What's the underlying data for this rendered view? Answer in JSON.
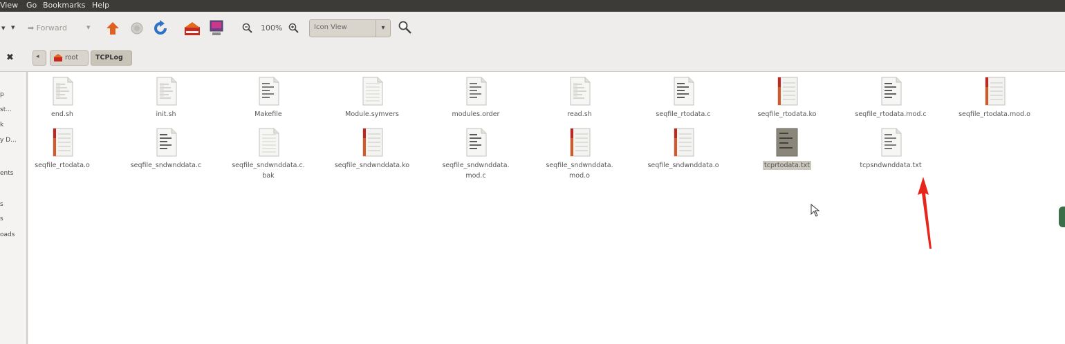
{
  "menu": {
    "items": [
      "View",
      "Go",
      "Bookmarks",
      "Help"
    ]
  },
  "toolbar": {
    "forward_label": "Forward",
    "zoom_label": "100%",
    "view_select": "Icon View"
  },
  "location": {
    "crumbs": [
      "root",
      "TCPLog"
    ]
  },
  "sidebar": {
    "items": [
      "p",
      "st...",
      "k",
      "y D...",
      "ents",
      "s",
      "s",
      "oads"
    ]
  },
  "files": [
    {
      "name": "end.sh",
      "type": "script",
      "selected": false
    },
    {
      "name": "init.sh",
      "type": "script",
      "selected": false
    },
    {
      "name": "Makefile",
      "type": "text",
      "selected": false
    },
    {
      "name": "Module.symvers",
      "type": "plain",
      "selected": false
    },
    {
      "name": "modules.order",
      "type": "text",
      "selected": false
    },
    {
      "name": "read.sh",
      "type": "script",
      "selected": false
    },
    {
      "name": "seqfile_rtodata.c",
      "type": "csrc",
      "selected": false
    },
    {
      "name": "seqfile_rtodata.ko",
      "type": "binary",
      "selected": false
    },
    {
      "name": "seqfile_rtodata.mod.c",
      "type": "csrc",
      "selected": false
    },
    {
      "name": "seqfile_rtodata.mod.o",
      "type": "binary",
      "selected": false
    },
    {
      "name": "seqfile_rtodata.o",
      "type": "binary",
      "selected": false
    },
    {
      "name": "seqfile_sndwnddata.c",
      "type": "csrc",
      "selected": false
    },
    {
      "name": "seqfile_sndwnddata.c.\nbak",
      "type": "plain",
      "selected": false
    },
    {
      "name": "seqfile_sndwnddata.ko",
      "type": "binary",
      "selected": false
    },
    {
      "name": "seqfile_sndwnddata.\nmod.c",
      "type": "csrc",
      "selected": false
    },
    {
      "name": "seqfile_sndwnddata.\nmod.o",
      "type": "binary",
      "selected": false
    },
    {
      "name": "seqfile_sndwnddata.o",
      "type": "binary",
      "selected": false
    },
    {
      "name": "tcprtodata.txt",
      "type": "textdark",
      "selected": true
    },
    {
      "name": "tcpsndwnddata.txt",
      "type": "text",
      "selected": false
    }
  ],
  "colors": {
    "menubar": "#3c3b37",
    "selection": "#cbc7bd",
    "arrow": "#e8251b"
  }
}
